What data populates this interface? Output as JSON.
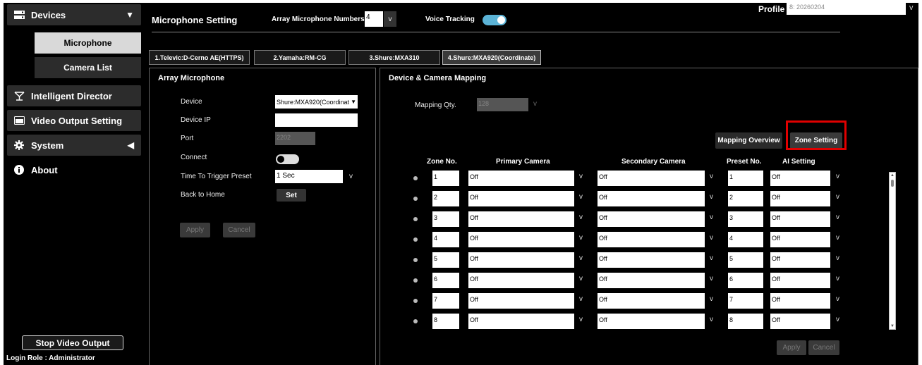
{
  "sidebar": {
    "devices": "Devices",
    "microphone": "Microphone",
    "camera_list": "Camera List",
    "intelligent_director": "Intelligent Director",
    "video_output_setting": "Video Output Setting",
    "system": "System",
    "about": "About",
    "stop_video_output": "Stop Video Output",
    "login_role": "Login Role : Administrator"
  },
  "header": {
    "title": "Microphone Setting",
    "array_mic_numbers_label": "Array Microphone Numbers",
    "array_mic_numbers_value": "4",
    "voice_tracking_label": "Voice Tracking",
    "voice_tracking_on": true,
    "profile_label": "Profile",
    "profile_value": "8: 20260204"
  },
  "tabs": [
    {
      "label": "1.Televic:D-Cerno AE(HTTPS)"
    },
    {
      "label": "2.Yamaha:RM-CG"
    },
    {
      "label": "3.Shure:MXA310"
    },
    {
      "label": "4.Shure:MXA920(Coordinate)",
      "active": true
    }
  ],
  "array_panel": {
    "title": "Array Microphone",
    "device_label": "Device",
    "device_value": "Shure:MXA920(Coordinat",
    "device_ip_label": "Device IP",
    "device_ip_value": "",
    "port_label": "Port",
    "port_value": "2202",
    "connect_label": "Connect",
    "trigger_label": "Time To Trigger Preset",
    "trigger_value": "1 Sec",
    "back_home_label": "Back to Home",
    "set_button": "Set",
    "apply_button": "Apply",
    "cancel_button": "Cancel"
  },
  "mapping_panel": {
    "title": "Device & Camera Mapping",
    "qty_label": "Mapping Qty.",
    "qty_value": "128",
    "mapping_overview_button": "Mapping Overview",
    "zone_setting_button": "Zone Setting",
    "columns": {
      "zone_no": "Zone No.",
      "primary_camera": "Primary Camera",
      "secondary_camera": "Secondary Camera",
      "preset_no": "Preset No.",
      "ai_setting": "AI Setting"
    },
    "rows": [
      {
        "zone": "1",
        "primary": "Off",
        "secondary": "Off",
        "preset": "1",
        "ai": "Off"
      },
      {
        "zone": "2",
        "primary": "Off",
        "secondary": "Off",
        "preset": "2",
        "ai": "Off"
      },
      {
        "zone": "3",
        "primary": "Off",
        "secondary": "Off",
        "preset": "3",
        "ai": "Off"
      },
      {
        "zone": "4",
        "primary": "Off",
        "secondary": "Off",
        "preset": "4",
        "ai": "Off"
      },
      {
        "zone": "5",
        "primary": "Off",
        "secondary": "Off",
        "preset": "5",
        "ai": "Off"
      },
      {
        "zone": "6",
        "primary": "Off",
        "secondary": "Off",
        "preset": "6",
        "ai": "Off"
      },
      {
        "zone": "7",
        "primary": "Off",
        "secondary": "Off",
        "preset": "7",
        "ai": "Off"
      },
      {
        "zone": "8",
        "primary": "Off",
        "secondary": "Off",
        "preset": "8",
        "ai": "Off"
      }
    ],
    "apply_button": "Apply",
    "cancel_button": "Cancel"
  },
  "colors": {
    "background": "#000000",
    "accent_toggle": "#5bb3d6",
    "highlight_box": "#e00000",
    "active_subitem": "#d9d9d9"
  }
}
